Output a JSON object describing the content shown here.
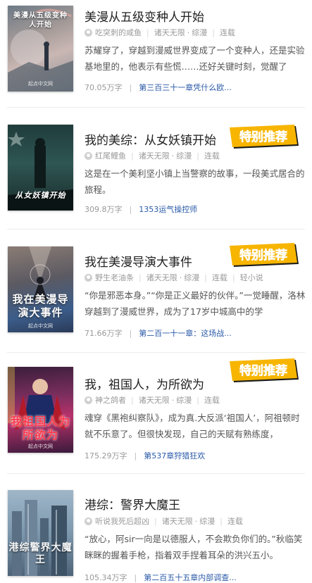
{
  "books": [
    {
      "title": "美漫从五级变种人开始",
      "author": "吃突刺的咸鱼",
      "tags": [
        "诸天无限",
        "综漫",
        "连载"
      ],
      "description": "苏耀穿了，穿越到漫威世界变成了一个变种人，还是实验基地里的，他表示有些慌……还好关键时刻，觉醒了",
      "words": "70.05万字",
      "latest": "第三百三十一章凭什么欧...",
      "cover_title": "美漫从五级变种人开始",
      "cover_publisher": "起点中文网",
      "featured": false
    },
    {
      "title": "我的美综：从女妖镇开始",
      "author": "红尾鲤鱼",
      "tags": [
        "诸天无限",
        "综漫",
        "连载"
      ],
      "description": "这是在一个美利坚小镇上当警察的故事，一段美式居合的旅程。",
      "words": "309.8万字",
      "latest": "1353运气操控师",
      "cover_title": "从女妖镇开始",
      "cover_publisher": "",
      "featured": true
    },
    {
      "title": "我在美漫导演大事件",
      "author": "野生老油条",
      "tags": [
        "诸天无限",
        "综漫",
        "连载",
        "轻小说"
      ],
      "description": "“你是邪恶本身。”“你是正义最好的伙伴。”一觉睡醒，洛林穿越到了漫威世界，成为了17岁中城高中的学",
      "words": "71.66万字",
      "latest": "第二百一十一章：这场战...",
      "cover_title": "我在美漫导演大事件",
      "cover_publisher": "起点中文网",
      "featured": true
    },
    {
      "title": "我，祖国人，为所欲为",
      "author": "神之鸽者",
      "tags": [
        "诸天无限",
        "综漫",
        "连载"
      ],
      "description": "魂穿《黑袍纠察队》，成为真.大反派‘祖国人’，阿祖顿时就不乐意了。但很快发现，自己的天赋有熟练度，",
      "words": "175.29万字",
      "latest": "第537章狩猎狂欢",
      "cover_title": "我祖国人为所欲为",
      "cover_publisher": "起点中文网",
      "featured": true
    },
    {
      "title": "港综：警界大魔王",
      "author": "听说我死后超凶",
      "tags": [
        "诸天无限",
        "综漫",
        "连载"
      ],
      "description": "“放心，阿sir一向是以德服人，不会欺负你们的。”秋临笑眯眯的握着手枪，指着双手捏着耳朵的洪兴五小。",
      "words": "105.34万字",
      "latest": "第二百五十五章内部调查...",
      "cover_title": "港综警界大魔王",
      "cover_publisher": "",
      "featured": false
    }
  ],
  "badge_label": "特别推荐",
  "colors": {
    "chapter_link": "#2a5aa8",
    "badge_fill": "#f7b500",
    "badge_text": "#1a1a1a"
  }
}
